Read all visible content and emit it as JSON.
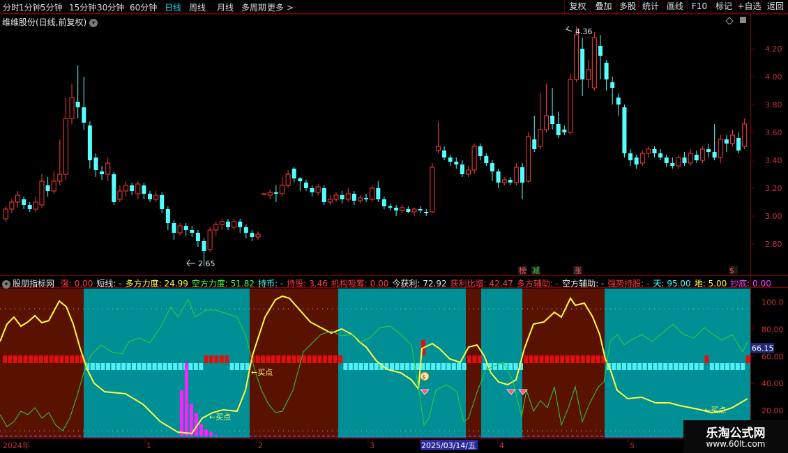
{
  "topbar": {
    "periods": [
      {
        "label": "分时",
        "active": false
      },
      {
        "label": "1分钟",
        "active": false
      },
      {
        "label": "5分钟",
        "active": false
      },
      {
        "label": "15分钟",
        "active": false
      },
      {
        "label": "30分钟",
        "active": false
      },
      {
        "label": "60分钟",
        "active": false
      },
      {
        "label": "日线",
        "active": true
      },
      {
        "label": "周线",
        "active": false
      },
      {
        "label": "月线",
        "active": false
      },
      {
        "label": "多周期",
        "active": false
      },
      {
        "label": "更多 >",
        "active": false
      }
    ],
    "buttons": [
      "复权",
      "叠加",
      "多股",
      "统计",
      "画线",
      "F10",
      "标记",
      "+自选",
      "返回"
    ]
  },
  "title": {
    "stock": "维维股份(日线,前复权)",
    "expand_icon": "chevron-down-icon"
  },
  "price_axis": {
    "ticks": [
      "4.20",
      "4.00",
      "3.80",
      "3.60",
      "3.40",
      "3.20",
      "3.00",
      "2.80"
    ]
  },
  "price_annotations": {
    "high": "4.36",
    "low": "2.65"
  },
  "markers": [
    {
      "text": "榜",
      "color": "#ff5555"
    },
    {
      "text": "减",
      "color": "#40d040"
    },
    {
      "text": "涨",
      "color": "#ff5555"
    },
    {
      "text": "$",
      "color": "#ff5555"
    }
  ],
  "indicator": {
    "name": "股朋指标网",
    "items": [
      {
        "label": "强:",
        "value": "0.00",
        "color": "#ff3b3b"
      },
      {
        "label": "短线:",
        "value": "-",
        "color": "#e8e8e8"
      },
      {
        "label": "多方力度:",
        "value": "24.99",
        "color": "#ffff40"
      },
      {
        "label": "空方力度:",
        "value": "51.82",
        "color": "#40ff40"
      },
      {
        "label": "持币:",
        "value": "-",
        "color": "#40ffff"
      },
      {
        "label": "持股:",
        "value": "3.46",
        "color": "#ff3b3b"
      },
      {
        "label": "机构吸筹:",
        "value": "0.00",
        "color": "#ff3b3b"
      },
      {
        "label": "今获利:",
        "value": "72.92",
        "color": "#e8e8e8"
      },
      {
        "label": "获利比增:",
        "value": "42.47",
        "color": "#ff3b3b"
      },
      {
        "label": "多方辅助:",
        "value": "-",
        "color": "#ff3b3b"
      },
      {
        "label": "空方辅助:",
        "value": "-",
        "color": "#e8e8e8"
      },
      {
        "label": "强势持股:",
        "value": "-",
        "color": "#ff3b3b"
      },
      {
        "label": "天:",
        "value": "95.00",
        "color": "#40ffff"
      },
      {
        "label": "地:",
        "value": "5.00",
        "color": "#ffff40"
      },
      {
        "label": "抄底:",
        "value": "0.00",
        "color": "#ff40ff"
      }
    ],
    "axis_ticks": [
      "100.0",
      "80.00",
      "60.00",
      "40.00",
      "20.00"
    ],
    "current_value": "66.15",
    "buy_labels": [
      "买点",
      "买点",
      "买点"
    ]
  },
  "date_axis": {
    "labels": [
      "2024年",
      "1",
      "2",
      "3",
      "2025/03/14/五",
      "4",
      "5"
    ]
  },
  "watermark": {
    "line1": "乐淘公式网",
    "line2": "www.60lt.com"
  },
  "colors": {
    "up": "#ff3b3b",
    "down": "#54ffff",
    "bull_bg": "#5a1200",
    "bear_bg": "#008f94",
    "yellow": "#ffff40",
    "green": "#30d030"
  },
  "chart_data": {
    "type": "candlestick",
    "price_range": [
      2.6,
      4.45
    ],
    "candles": [
      [
        2.98,
        3.05,
        3.07,
        2.96
      ],
      [
        3.05,
        3.1,
        3.12,
        3.02
      ],
      [
        3.1,
        3.15,
        3.18,
        3.06
      ],
      [
        3.12,
        3.08,
        3.14,
        3.05
      ],
      [
        3.08,
        3.05,
        3.1,
        3.03
      ],
      [
        3.05,
        3.1,
        3.14,
        3.03
      ],
      [
        3.08,
        3.25,
        3.3,
        3.06
      ],
      [
        3.22,
        3.18,
        3.28,
        3.14
      ],
      [
        3.18,
        3.25,
        3.32,
        3.16
      ],
      [
        3.25,
        3.3,
        3.55,
        3.22
      ],
      [
        3.3,
        3.7,
        3.85,
        3.26
      ],
      [
        3.7,
        3.85,
        3.95,
        3.66
      ],
      [
        3.82,
        3.78,
        4.08,
        3.7
      ],
      [
        3.78,
        3.67,
        4.0,
        3.62
      ],
      [
        3.65,
        3.4,
        3.68,
        3.34
      ],
      [
        3.42,
        3.33,
        3.45,
        3.28
      ],
      [
        3.32,
        3.3,
        3.36,
        3.26
      ],
      [
        3.3,
        3.38,
        3.42,
        3.25
      ],
      [
        3.3,
        3.1,
        3.32,
        3.08
      ],
      [
        3.12,
        3.18,
        3.22,
        3.1
      ],
      [
        3.18,
        3.22,
        3.25,
        3.14
      ],
      [
        3.22,
        3.18,
        3.24,
        3.15
      ],
      [
        3.16,
        3.23,
        3.25,
        3.12
      ],
      [
        3.22,
        3.16,
        3.24,
        3.12
      ],
      [
        3.16,
        3.12,
        3.18,
        3.1
      ],
      [
        3.12,
        3.15,
        3.18,
        3.1
      ],
      [
        3.15,
        3.05,
        3.17,
        3.02
      ],
      [
        3.05,
        2.95,
        3.07,
        2.9
      ],
      [
        2.95,
        2.88,
        2.97,
        2.83
      ],
      [
        2.88,
        2.93,
        2.95,
        2.86
      ],
      [
        2.93,
        2.9,
        2.95,
        2.86
      ],
      [
        2.9,
        2.88,
        2.93,
        2.85
      ],
      [
        2.88,
        2.82,
        2.9,
        2.78
      ],
      [
        2.82,
        2.75,
        2.84,
        2.65
      ],
      [
        2.76,
        2.9,
        2.92,
        2.74
      ],
      [
        2.9,
        2.94,
        2.96,
        2.86
      ],
      [
        2.94,
        2.96,
        2.98,
        2.9
      ],
      [
        2.96,
        2.92,
        2.98,
        2.9
      ],
      [
        2.92,
        2.96,
        2.98,
        2.9
      ],
      [
        2.96,
        2.92,
        2.98,
        2.88
      ],
      [
        2.92,
        2.88,
        2.94,
        2.84
      ],
      [
        2.88,
        2.85,
        2.9,
        2.82
      ],
      [
        2.85,
        2.87,
        2.89,
        2.83
      ],
      [
        3.16,
        3.16,
        3.16,
        3.16
      ],
      [
        3.15,
        3.17,
        3.19,
        3.12
      ],
      [
        3.17,
        3.16,
        3.22,
        3.1
      ],
      [
        3.16,
        3.22,
        3.28,
        3.14
      ],
      [
        3.22,
        3.3,
        3.33,
        3.2
      ],
      [
        3.34,
        3.27,
        3.35,
        3.24
      ],
      [
        3.27,
        3.25,
        3.28,
        3.18
      ],
      [
        3.24,
        3.2,
        3.26,
        3.18
      ],
      [
        3.2,
        3.17,
        3.22,
        3.14
      ],
      [
        3.17,
        3.21,
        3.23,
        3.15
      ],
      [
        3.2,
        3.1,
        3.22,
        3.08
      ],
      [
        3.1,
        3.12,
        3.15,
        3.08
      ],
      [
        3.12,
        3.15,
        3.17,
        3.1
      ],
      [
        3.15,
        3.12,
        3.18,
        3.09
      ],
      [
        3.12,
        3.16,
        3.2,
        3.1
      ],
      [
        3.16,
        3.11,
        3.18,
        3.08
      ],
      [
        3.11,
        3.13,
        3.15,
        3.09
      ],
      [
        3.13,
        3.12,
        3.16,
        3.1
      ],
      [
        3.12,
        3.2,
        3.22,
        3.1
      ],
      [
        3.2,
        3.12,
        3.25,
        3.1
      ],
      [
        3.12,
        3.07,
        3.14,
        3.05
      ],
      [
        3.07,
        3.06,
        3.09,
        3.04
      ],
      [
        3.06,
        3.04,
        3.08,
        3.0
      ],
      [
        3.04,
        3.06,
        3.08,
        3.02
      ],
      [
        3.05,
        3.03,
        3.07,
        3.02
      ],
      [
        3.03,
        3.05,
        3.06,
        3.0
      ],
      [
        3.05,
        3.04,
        3.07,
        3.02
      ],
      [
        3.03,
        3.02,
        3.05,
        3.0
      ],
      [
        3.03,
        3.35,
        3.38,
        3.02
      ],
      [
        3.47,
        3.5,
        3.68,
        3.45
      ],
      [
        3.47,
        3.42,
        3.5,
        3.4
      ],
      [
        3.42,
        3.39,
        3.44,
        3.36
      ],
      [
        3.39,
        3.37,
        3.42,
        3.34
      ],
      [
        3.37,
        3.3,
        3.4,
        3.28
      ],
      [
        3.3,
        3.33,
        3.36,
        3.28
      ],
      [
        3.33,
        3.5,
        3.52,
        3.3
      ],
      [
        3.5,
        3.43,
        3.52,
        3.4
      ],
      [
        3.43,
        3.38,
        3.45,
        3.36
      ],
      [
        3.38,
        3.32,
        3.4,
        3.25
      ],
      [
        3.32,
        3.24,
        3.34,
        3.2
      ],
      [
        3.24,
        3.26,
        3.28,
        3.22
      ],
      [
        3.26,
        3.24,
        3.28,
        3.22
      ],
      [
        3.24,
        3.35,
        3.38,
        3.22
      ],
      [
        3.35,
        3.24,
        3.38,
        3.12
      ],
      [
        3.25,
        3.57,
        3.6,
        3.24
      ],
      [
        3.55,
        3.48,
        3.72,
        3.46
      ],
      [
        3.5,
        3.62,
        3.88,
        3.48
      ],
      [
        3.62,
        3.72,
        3.95,
        3.6
      ],
      [
        3.72,
        3.66,
        3.92,
        3.62
      ],
      [
        3.66,
        3.58,
        3.75,
        3.56
      ],
      [
        3.62,
        3.6,
        3.65,
        3.58
      ],
      [
        3.6,
        3.98,
        4.02,
        3.58
      ],
      [
        3.98,
        4.3,
        4.36,
        3.96
      ],
      [
        4.2,
        3.98,
        4.28,
        3.86
      ],
      [
        3.98,
        4.05,
        4.12,
        3.92
      ],
      [
        3.92,
        4.28,
        4.32,
        3.9
      ],
      [
        4.22,
        4.15,
        4.3,
        3.98
      ],
      [
        4.1,
        3.98,
        4.12,
        3.9
      ],
      [
        3.96,
        3.92,
        4.0,
        3.8
      ],
      [
        3.85,
        3.8,
        3.88,
        3.72
      ],
      [
        3.78,
        3.45,
        3.8,
        3.42
      ],
      [
        3.45,
        3.4,
        3.48,
        3.36
      ],
      [
        3.42,
        3.37,
        3.44,
        3.34
      ],
      [
        3.38,
        3.45,
        3.47,
        3.36
      ],
      [
        3.45,
        3.48,
        3.5,
        3.42
      ],
      [
        3.48,
        3.45,
        3.5,
        3.42
      ],
      [
        3.45,
        3.42,
        3.48,
        3.4
      ],
      [
        3.42,
        3.38,
        3.44,
        3.35
      ],
      [
        3.38,
        3.36,
        3.42,
        3.34
      ],
      [
        3.36,
        3.42,
        3.44,
        3.34
      ],
      [
        3.42,
        3.38,
        3.46,
        3.36
      ],
      [
        3.38,
        3.45,
        3.48,
        3.36
      ],
      [
        3.44,
        3.4,
        3.47,
        3.38
      ],
      [
        3.4,
        3.48,
        3.5,
        3.38
      ],
      [
        3.48,
        3.46,
        3.52,
        3.42
      ],
      [
        3.46,
        3.42,
        3.66,
        3.4
      ],
      [
        3.42,
        3.55,
        3.58,
        3.38
      ],
      [
        3.55,
        3.52,
        3.58,
        3.46
      ],
      [
        3.52,
        3.58,
        3.62,
        3.5
      ],
      [
        3.56,
        3.47,
        3.6,
        3.45
      ],
      [
        3.5,
        3.66,
        3.7,
        3.48
      ]
    ]
  }
}
